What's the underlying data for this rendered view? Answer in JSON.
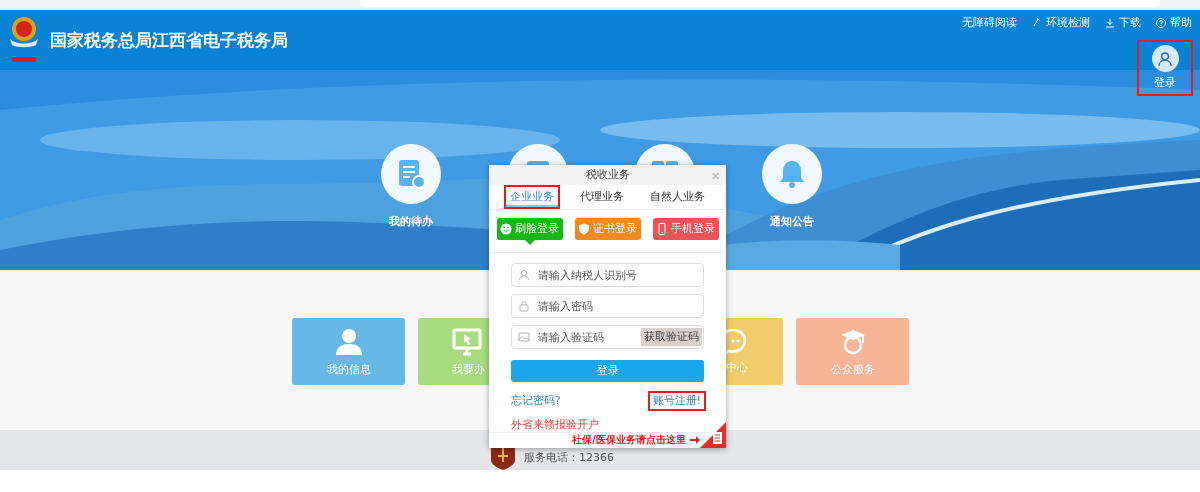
{
  "header": {
    "title": "国家税务总局江西省电子税务局",
    "links": [
      {
        "label": "无障碍阅读"
      },
      {
        "label": "环境检测"
      },
      {
        "label": "下载"
      },
      {
        "label": "帮助"
      }
    ],
    "login": {
      "label": "登录",
      "annotated": true
    }
  },
  "banner": {
    "features": [
      {
        "kind": "labeled",
        "label": "我的待办"
      },
      {
        "kind": "covered"
      },
      {
        "kind": "covered"
      },
      {
        "kind": "labeled",
        "label": "通知公告"
      }
    ]
  },
  "tiles": [
    {
      "label": "我的信息",
      "color": "#66b8e6"
    },
    {
      "label": "我要办",
      "color": "#a6dc7f"
    },
    {
      "label": "中心",
      "color": "#f0cd6a"
    },
    {
      "label": "公众服务",
      "color": "#f5b596"
    }
  ],
  "footer": {
    "phone": "服务电话：12366"
  },
  "dialog": {
    "title": "税收业务",
    "close": "×",
    "tabs": [
      {
        "label": "企业业务",
        "selected": true,
        "annotated": true
      },
      {
        "label": "代理业务",
        "selected": false,
        "annotated": false
      },
      {
        "label": "自然人业务",
        "selected": false,
        "annotated": false
      }
    ],
    "methods": [
      {
        "label": "刷脸登录",
        "color": "#16b816",
        "selected": true
      },
      {
        "label": "证书登录",
        "color": "#f08a1e",
        "selected": false
      },
      {
        "label": "手机登录",
        "color": "#ea5454",
        "selected": false
      }
    ],
    "fields": [
      {
        "placeholder": "请输入纳税人识别号"
      },
      {
        "placeholder": "请输入密码"
      },
      {
        "placeholder": "请输入验证码",
        "action": "获取验证码"
      }
    ],
    "submit": "登录",
    "forgot": "忘记密码?",
    "register": {
      "label": "账号注册!",
      "annotated": true
    },
    "other": "外省来赣报验开户",
    "banner_link": "社保/医保业务请点击这里"
  }
}
